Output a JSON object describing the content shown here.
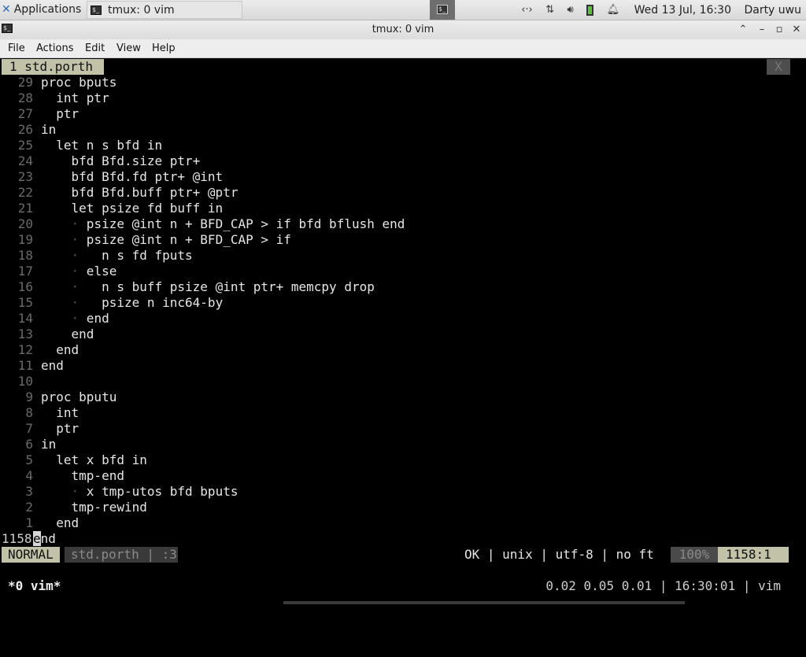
{
  "panel": {
    "apps_label": "Applications",
    "task_label": "tmux: 0 vim",
    "clock": "Wed 13 Jul, 16:30",
    "user": "Darty uwu"
  },
  "window": {
    "title": "tmux: 0 vim"
  },
  "menubar": {
    "file": "File",
    "actions": "Actions",
    "edit": "Edit",
    "view": "View",
    "help": "Help"
  },
  "vim": {
    "tab_label": "1 std.porth",
    "tab_close": "X",
    "lines": [
      {
        "n": "29",
        "text": "proc bputs"
      },
      {
        "n": "28",
        "text": "  int ptr"
      },
      {
        "n": "27",
        "text": "  ptr"
      },
      {
        "n": "26",
        "text": "in"
      },
      {
        "n": "25",
        "text": "  let n s bfd in"
      },
      {
        "n": "24",
        "text": "    bfd Bfd.size ptr+"
      },
      {
        "n": "23",
        "text": "    bfd Bfd.fd ptr+ @int"
      },
      {
        "n": "22",
        "text": "    bfd Bfd.buff ptr+ @ptr"
      },
      {
        "n": "21",
        "text": "    let psize fd buff in"
      },
      {
        "n": "20",
        "text": "    · psize @int n + BFD_CAP > if bfd bflush end"
      },
      {
        "n": "19",
        "text": "    · psize @int n + BFD_CAP > if"
      },
      {
        "n": "18",
        "text": "    ·   n s fd fputs"
      },
      {
        "n": "17",
        "text": "    · else"
      },
      {
        "n": "16",
        "text": "    ·   n s buff psize @int ptr+ memcpy drop"
      },
      {
        "n": "15",
        "text": "    ·   psize n inc64-by"
      },
      {
        "n": "14",
        "text": "    · end"
      },
      {
        "n": "13",
        "text": "    end"
      },
      {
        "n": "12",
        "text": "  end"
      },
      {
        "n": "11",
        "text": "end"
      },
      {
        "n": "10",
        "text": ""
      },
      {
        "n": "9",
        "text": "proc bputu"
      },
      {
        "n": "8",
        "text": "  int"
      },
      {
        "n": "7",
        "text": "  ptr"
      },
      {
        "n": "6",
        "text": "in"
      },
      {
        "n": "5",
        "text": "  let x bfd in"
      },
      {
        "n": "4",
        "text": "    tmp-end"
      },
      {
        "n": "3",
        "text": "    · x tmp-utos bfd bputs"
      },
      {
        "n": "2",
        "text": "    tmp-rewind"
      },
      {
        "n": "1",
        "text": "  end"
      }
    ],
    "current_line": {
      "n": "1158",
      "cursor_char": "e",
      "rest": "nd"
    },
    "status": {
      "mode": "NORMAL",
      "file": "std.porth",
      "sep_col": "| :3",
      "format": "OK | unix | utf-8 | no ft",
      "percent": "100%",
      "position": "1158:1"
    }
  },
  "tmux": {
    "window": "*0 vim*",
    "right": "0.02 0.05 0.01 | 16:30:01 | vim"
  }
}
